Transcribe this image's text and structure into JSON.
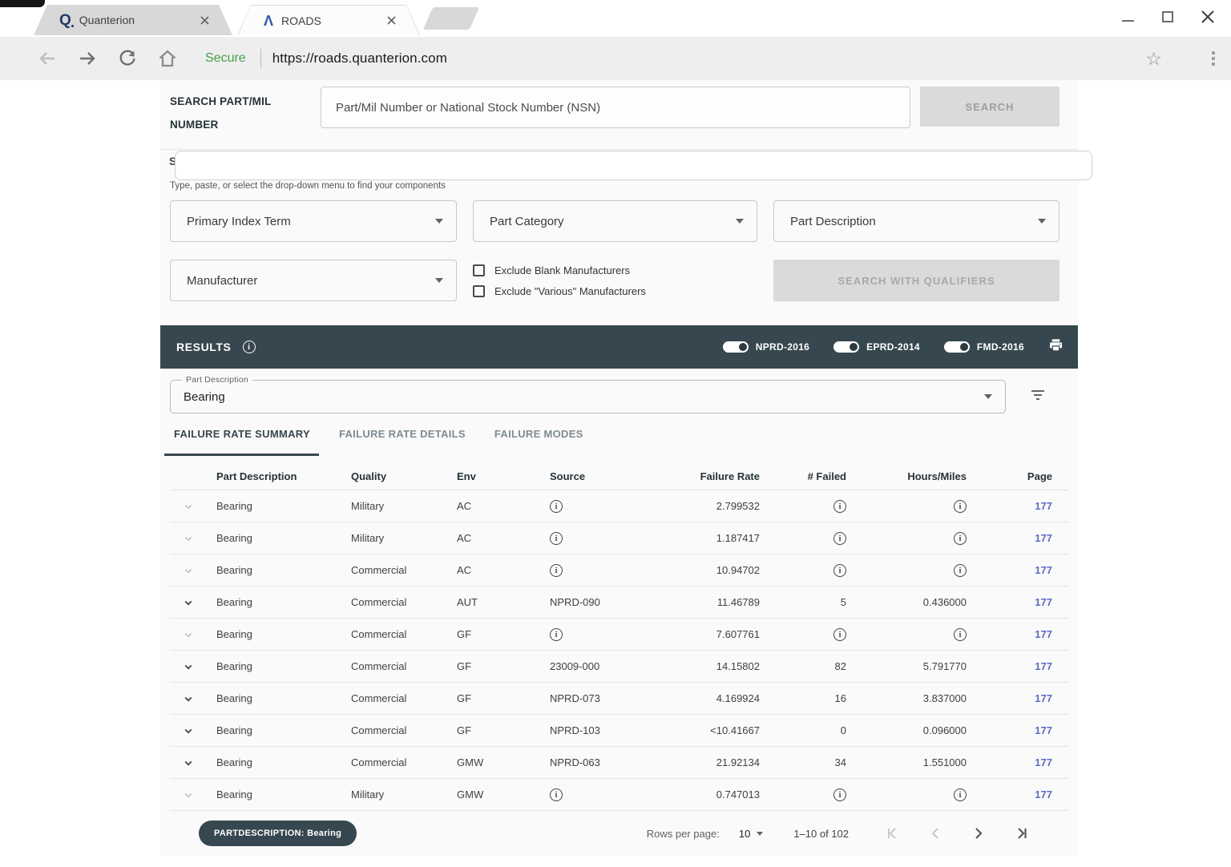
{
  "browser": {
    "tabs": [
      {
        "label": "Quanterion"
      },
      {
        "label": "ROADS"
      }
    ],
    "secure_label": "Secure",
    "url": "https://roads.quanterion.com"
  },
  "search_panel": {
    "part_mil_label": "SEARCH PART/MIL NUMBER",
    "part_mil_placeholder": "Part/Mil Number or National Stock Number (NSN)",
    "search_button": "SEARCH",
    "obscured_label_fragment": "S",
    "helper_text": "Type, paste, or select the drop-down menu to find your components",
    "dropdowns": [
      "Primary Index Term",
      "Part Category",
      "Part Description",
      "Manufacturer"
    ],
    "checkboxes": [
      "Exclude Blank Manufacturers",
      "Exclude \"Various\" Manufacturers"
    ],
    "qualifiers_button": "SEARCH WITH QUALIFIERS"
  },
  "results": {
    "title": "RESULTS",
    "toggles": [
      {
        "label": "NPRD-2016",
        "on": true
      },
      {
        "label": "EPRD-2014",
        "on": true
      },
      {
        "label": "FMD-2016",
        "on": true
      }
    ],
    "filter_field": {
      "label": "Part Description",
      "value": "Bearing"
    },
    "tabs": [
      {
        "label": "FAILURE RATE SUMMARY",
        "active": true
      },
      {
        "label": "FAILURE RATE DETAILS",
        "active": false
      },
      {
        "label": "FAILURE MODES",
        "active": false
      }
    ],
    "table": {
      "columns": [
        "Part Description",
        "Quality",
        "Env",
        "Source",
        "Failure Rate",
        "# Failed",
        "Hours/Miles",
        "Page"
      ],
      "rows": [
        {
          "expand_dark": false,
          "part": "Bearing",
          "quality": "Military",
          "env": "AC",
          "source": null,
          "rate": "2.799532",
          "failed": null,
          "hours": null,
          "page": "177"
        },
        {
          "expand_dark": false,
          "part": "Bearing",
          "quality": "Military",
          "env": "AC",
          "source": null,
          "rate": "1.187417",
          "failed": null,
          "hours": null,
          "page": "177"
        },
        {
          "expand_dark": false,
          "part": "Bearing",
          "quality": "Commercial",
          "env": "AC",
          "source": null,
          "rate": "10.94702",
          "failed": null,
          "hours": null,
          "page": "177"
        },
        {
          "expand_dark": true,
          "part": "Bearing",
          "quality": "Commercial",
          "env": "AUT",
          "source": "NPRD-090",
          "rate": "11.46789",
          "failed": "5",
          "hours": "0.436000",
          "page": "177"
        },
        {
          "expand_dark": false,
          "part": "Bearing",
          "quality": "Commercial",
          "env": "GF",
          "source": null,
          "rate": "7.607761",
          "failed": null,
          "hours": null,
          "page": "177"
        },
        {
          "expand_dark": true,
          "part": "Bearing",
          "quality": "Commercial",
          "env": "GF",
          "source": "23009-000",
          "rate": "14.15802",
          "failed": "82",
          "hours": "5.791770",
          "page": "177"
        },
        {
          "expand_dark": true,
          "part": "Bearing",
          "quality": "Commercial",
          "env": "GF",
          "source": "NPRD-073",
          "rate": "4.169924",
          "failed": "16",
          "hours": "3.837000",
          "page": "177"
        },
        {
          "expand_dark": true,
          "part": "Bearing",
          "quality": "Commercial",
          "env": "GF",
          "source": "NPRD-103",
          "rate": "<10.41667",
          "failed": "0",
          "hours": "0.096000",
          "page": "177"
        },
        {
          "expand_dark": true,
          "part": "Bearing",
          "quality": "Commercial",
          "env": "GMW",
          "source": "NPRD-063",
          "rate": "21.92134",
          "failed": "34",
          "hours": "1.551000",
          "page": "177"
        },
        {
          "expand_dark": false,
          "part": "Bearing",
          "quality": "Military",
          "env": "GMW",
          "source": null,
          "rate": "0.747013",
          "failed": null,
          "hours": null,
          "page": "177"
        }
      ]
    },
    "footer": {
      "chip": "PARTDESCRIPTION: Bearing",
      "rows_per_page_label": "Rows per page:",
      "rows_per_page_value": "10",
      "range_label": "1–10 of 102"
    }
  },
  "colors": {
    "header_bar": "#37474f",
    "page_link": "#5c6bc0",
    "secure_green": "#43a047",
    "disabled_button_bg": "#dadada"
  }
}
